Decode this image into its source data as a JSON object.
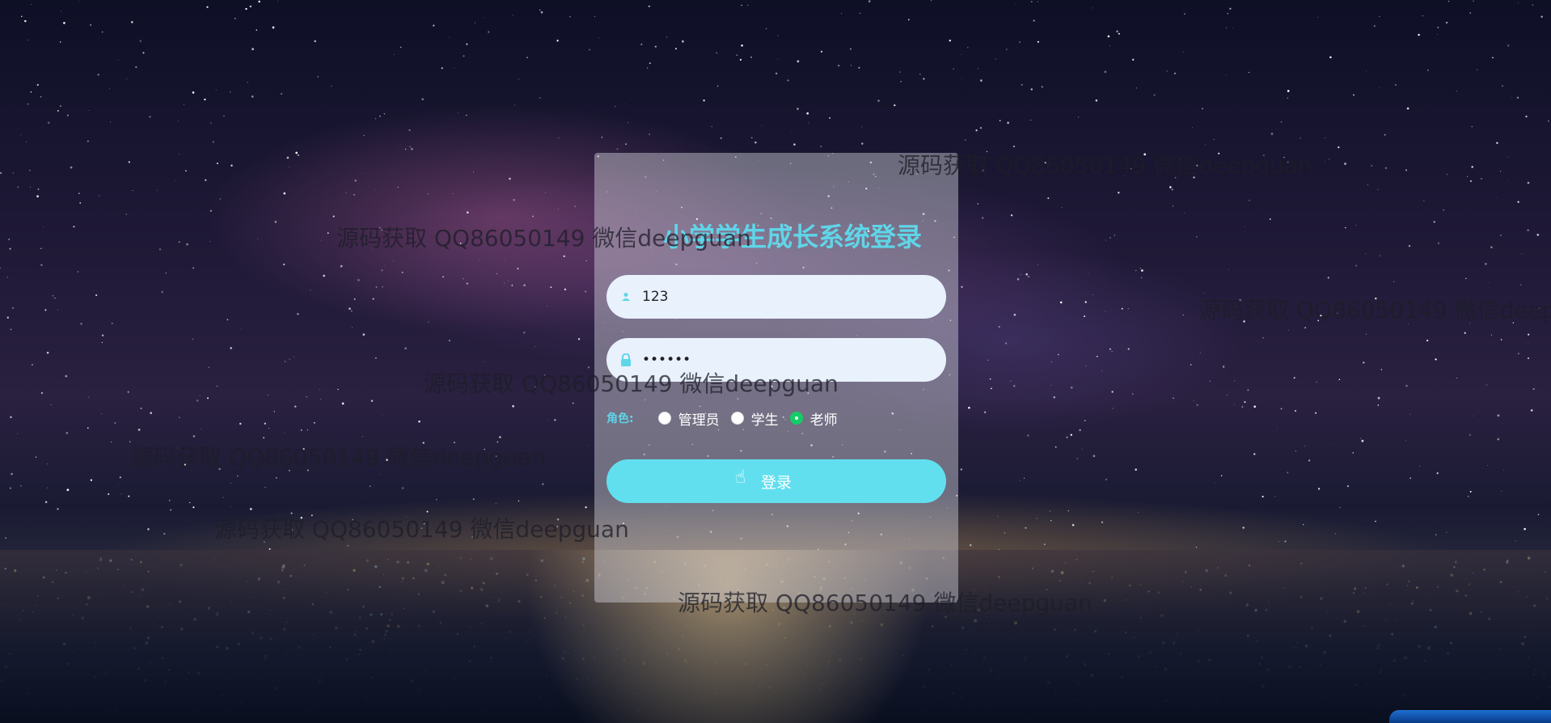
{
  "app": {
    "title": "小学学生成长系统登录"
  },
  "form": {
    "username_value": "123",
    "password_value": "••••••",
    "role_label": "角色:",
    "roles": [
      {
        "label": "管理员",
        "checked": false
      },
      {
        "label": "学生",
        "checked": false
      },
      {
        "label": "老师",
        "checked": true
      }
    ],
    "login_label": "登录"
  },
  "watermark_text": "源码获取 QQ86050149 微信deepguan",
  "colors": {
    "accent": "#5fd5e8",
    "button": "#62dfef",
    "radio_checked": "#13ce66",
    "input_bg": "#e8f1fc"
  },
  "icons": {
    "user": "user-icon",
    "lock": "lock-icon",
    "cursor": "hand-pointer-icon"
  }
}
